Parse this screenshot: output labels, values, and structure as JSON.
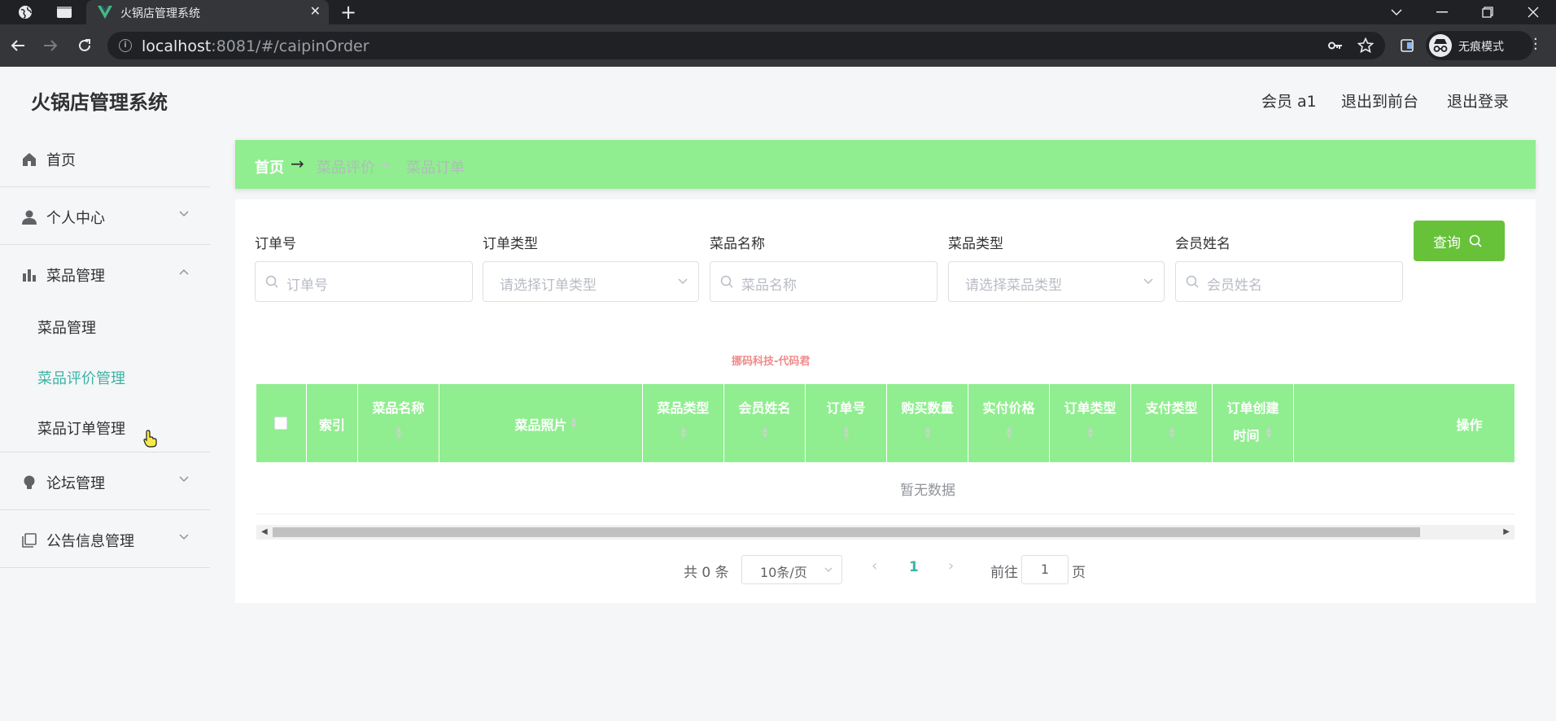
{
  "browser": {
    "tab_title": "火锅店管理系统",
    "url_host": "localhost",
    "url_rest": ":8081/#/caipinOrder",
    "incognito_label": "无痕模式"
  },
  "header": {
    "title": "火锅店管理系统",
    "user": "会员 a1",
    "back_front": "退出到前台",
    "logout": "退出登录"
  },
  "sidebar": {
    "items": [
      {
        "label": "首页",
        "icon": "home-icon"
      },
      {
        "label": "个人中心",
        "icon": "user-icon"
      },
      {
        "label": "菜品管理",
        "icon": "bar-chart-icon"
      },
      {
        "label": "论坛管理",
        "icon": "bulb-icon"
      },
      {
        "label": "公告信息管理",
        "icon": "copy-icon"
      }
    ],
    "sub_items": [
      {
        "label": "菜品管理"
      },
      {
        "label": "菜品评价管理"
      },
      {
        "label": "菜品订单管理"
      }
    ]
  },
  "breadcrumb": {
    "home": "首页",
    "sep": "→",
    "level1": "菜品评价",
    "level2": "菜品订单"
  },
  "filters": {
    "order_no": {
      "label": "订单号",
      "placeholder": "订单号"
    },
    "order_type": {
      "label": "订单类型",
      "placeholder": "请选择订单类型"
    },
    "dish_name": {
      "label": "菜品名称",
      "placeholder": "菜品名称"
    },
    "dish_type": {
      "label": "菜品类型",
      "placeholder": "请选择菜品类型"
    },
    "member_name": {
      "label": "会员姓名",
      "placeholder": "会员姓名"
    },
    "query_label": "查询"
  },
  "watermark": "挪码科技-代码君",
  "table": {
    "columns": [
      {
        "l1": "索引"
      },
      {
        "l1": "菜品名称"
      },
      {
        "l1": "菜品照片"
      },
      {
        "l1": "菜品类型"
      },
      {
        "l1": "会员姓名"
      },
      {
        "l1": "订单号"
      },
      {
        "l1": "购买数量"
      },
      {
        "l1": "实付价格"
      },
      {
        "l1": "订单类型"
      },
      {
        "l1": "支付类型"
      },
      {
        "l1": "订单创建",
        "l2": "时间"
      },
      {
        "l1": "操作"
      }
    ],
    "empty_text": "暂无数据"
  },
  "pagination": {
    "total": "共 0 条",
    "page_size": "10条/页",
    "current": "1",
    "goto_label": "前往",
    "goto_value": "1",
    "unit": "页"
  },
  "colors": {
    "header_bg": "#90ee90",
    "active_menu": "#3bb3a6",
    "query_button": "#67c23a"
  }
}
